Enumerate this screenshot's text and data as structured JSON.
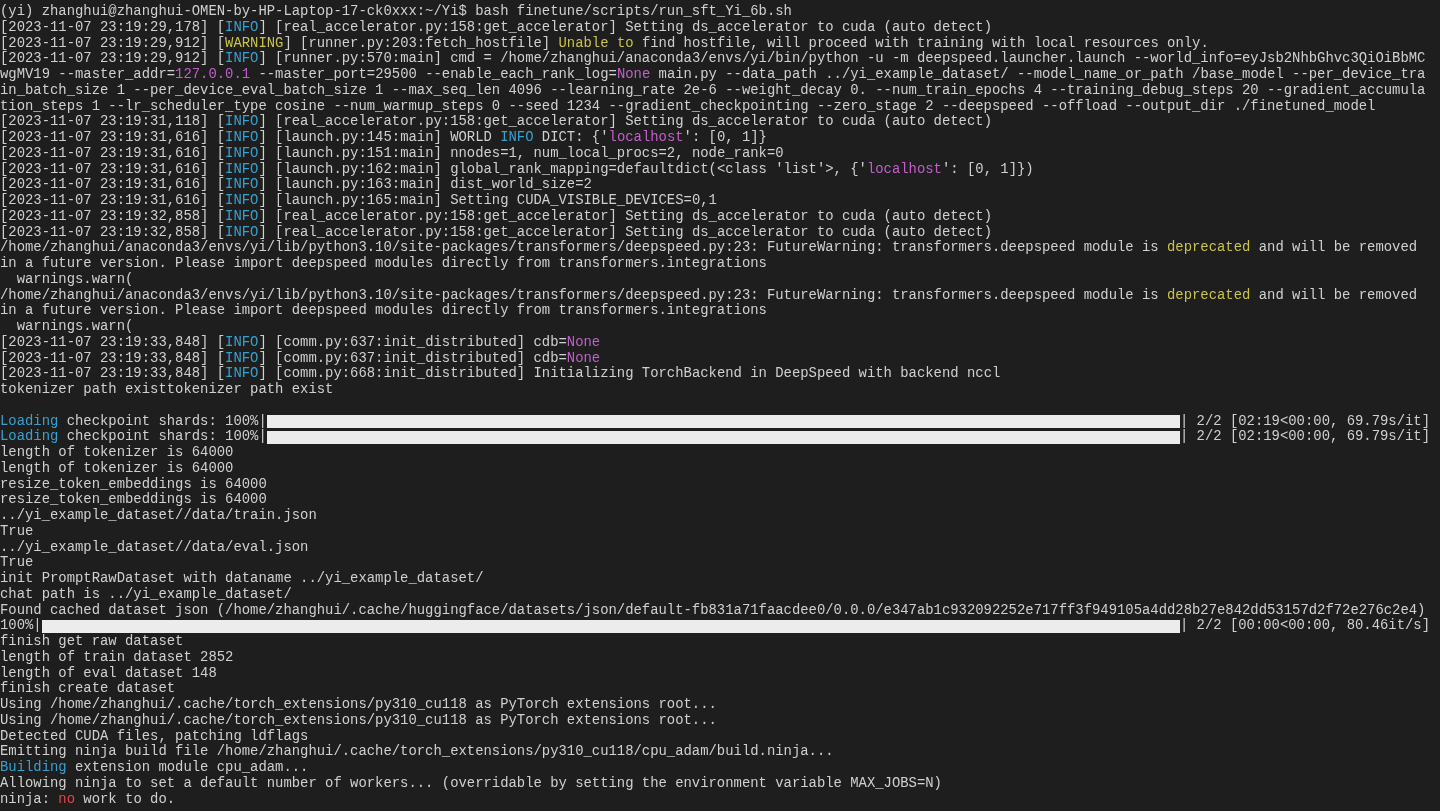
{
  "terminal": {
    "lines": [
      {
        "kind": "text",
        "segments": [
          {
            "kind": "plain",
            "text": "(yi) zhanghui@zhanghui-OMEN-by-HP-Laptop-17-ck0xxx:~/Yi$ bash finetune/scripts/run_sft_Yi_6b.sh"
          }
        ]
      },
      {
        "kind": "text",
        "segments": [
          {
            "kind": "plain",
            "text": "[2023-11-07 23:19:29,178] ["
          },
          {
            "kind": "info",
            "text": "INFO"
          },
          {
            "kind": "plain",
            "text": "] [real_accelerator.py:158:get_accelerator] Setting ds_accelerator to cuda (auto detect)"
          }
        ]
      },
      {
        "kind": "text",
        "segments": [
          {
            "kind": "plain",
            "text": "[2023-11-07 23:19:29,912] ["
          },
          {
            "kind": "warning",
            "text": "WARNING"
          },
          {
            "kind": "plain",
            "text": "] [runner.py:203:fetch_hostfile] "
          },
          {
            "kind": "warning",
            "text": "Unable to"
          },
          {
            "kind": "plain",
            "text": " find hostfile, will proceed with training with local resources only."
          }
        ]
      },
      {
        "kind": "text",
        "segments": [
          {
            "kind": "plain",
            "text": "[2023-11-07 23:19:29,912] ["
          },
          {
            "kind": "info",
            "text": "INFO"
          },
          {
            "kind": "plain",
            "text": "] [runner.py:570:main] cmd = /home/zhanghui/anaconda3/envs/yi/bin/python -u -m deepspeed.launcher.launch --world_info=eyJsb2NhbGhvc3QiOiBbMC"
          }
        ]
      },
      {
        "kind": "text",
        "segments": [
          {
            "kind": "plain",
            "text": "wgMV19 --master_addr="
          },
          {
            "kind": "value",
            "text": "127.0.0.1"
          },
          {
            "kind": "plain",
            "text": " --master_port=29500 --enable_each_rank_log="
          },
          {
            "kind": "value",
            "text": "None"
          },
          {
            "kind": "plain",
            "text": " main.py --data_path ../yi_example_dataset/ --model_name_or_path /base_model --per_device_tra"
          }
        ]
      },
      {
        "kind": "text",
        "segments": [
          {
            "kind": "plain",
            "text": "in_batch_size 1 --per_device_eval_batch_size 1 --max_seq_len 4096 --learning_rate 2e-6 --weight_decay 0. --num_train_epochs 4 --training_debug_steps 20 --gradient_accumula"
          }
        ]
      },
      {
        "kind": "text",
        "segments": [
          {
            "kind": "plain",
            "text": "tion_steps 1 --lr_scheduler_type cosine --num_warmup_steps 0 --seed 1234 --gradient_checkpointing --zero_stage 2 --deepspeed --offload --output_dir ./finetuned_model"
          }
        ]
      },
      {
        "kind": "text",
        "segments": [
          {
            "kind": "plain",
            "text": "[2023-11-07 23:19:31,118] ["
          },
          {
            "kind": "info",
            "text": "INFO"
          },
          {
            "kind": "plain",
            "text": "] [real_accelerator.py:158:get_accelerator] Setting ds_accelerator to cuda (auto detect)"
          }
        ]
      },
      {
        "kind": "text",
        "segments": [
          {
            "kind": "plain",
            "text": "[2023-11-07 23:19:31,616] ["
          },
          {
            "kind": "info",
            "text": "INFO"
          },
          {
            "kind": "plain",
            "text": "] [launch.py:145:main] WORLD "
          },
          {
            "kind": "info",
            "text": "INFO"
          },
          {
            "kind": "plain",
            "text": " DICT: {'"
          },
          {
            "kind": "value",
            "text": "localhost"
          },
          {
            "kind": "plain",
            "text": "': [0, 1]}"
          }
        ]
      },
      {
        "kind": "text",
        "segments": [
          {
            "kind": "plain",
            "text": "[2023-11-07 23:19:31,616] ["
          },
          {
            "kind": "info",
            "text": "INFO"
          },
          {
            "kind": "plain",
            "text": "] [launch.py:151:main] nnodes=1, num_local_procs=2, node_rank=0"
          }
        ]
      },
      {
        "kind": "text",
        "segments": [
          {
            "kind": "plain",
            "text": "[2023-11-07 23:19:31,616] ["
          },
          {
            "kind": "info",
            "text": "INFO"
          },
          {
            "kind": "plain",
            "text": "] [launch.py:162:main] global_rank_mapping=defaultdict(<class 'list'>, {'"
          },
          {
            "kind": "value",
            "text": "localhost"
          },
          {
            "kind": "plain",
            "text": "': [0, 1]})"
          }
        ]
      },
      {
        "kind": "text",
        "segments": [
          {
            "kind": "plain",
            "text": "[2023-11-07 23:19:31,616] ["
          },
          {
            "kind": "info",
            "text": "INFO"
          },
          {
            "kind": "plain",
            "text": "] [launch.py:163:main] dist_world_size=2"
          }
        ]
      },
      {
        "kind": "text",
        "segments": [
          {
            "kind": "plain",
            "text": "[2023-11-07 23:19:31,616] ["
          },
          {
            "kind": "info",
            "text": "INFO"
          },
          {
            "kind": "plain",
            "text": "] [launch.py:165:main] Setting CUDA_VISIBLE_DEVICES=0,1"
          }
        ]
      },
      {
        "kind": "text",
        "segments": [
          {
            "kind": "plain",
            "text": "[2023-11-07 23:19:32,858] ["
          },
          {
            "kind": "info",
            "text": "INFO"
          },
          {
            "kind": "plain",
            "text": "] [real_accelerator.py:158:get_accelerator] Setting ds_accelerator to cuda (auto detect)"
          }
        ]
      },
      {
        "kind": "text",
        "segments": [
          {
            "kind": "plain",
            "text": "[2023-11-07 23:19:32,858] ["
          },
          {
            "kind": "info",
            "text": "INFO"
          },
          {
            "kind": "plain",
            "text": "] [real_accelerator.py:158:get_accelerator] Setting ds_accelerator to cuda (auto detect)"
          }
        ]
      },
      {
        "kind": "text",
        "segments": [
          {
            "kind": "plain",
            "text": "/home/zhanghui/anaconda3/envs/yi/lib/python3.10/site-packages/transformers/deepspeed.py:23: FutureWarning: transformers.deepspeed module is "
          },
          {
            "kind": "warning",
            "text": "deprecated"
          },
          {
            "kind": "plain",
            "text": " and will be removed"
          }
        ]
      },
      {
        "kind": "text",
        "segments": [
          {
            "kind": "plain",
            "text": "in a future version. Please import deepspeed modules directly from transformers.integrations"
          }
        ]
      },
      {
        "kind": "text",
        "segments": [
          {
            "kind": "plain",
            "text": "  warnings.warn("
          }
        ]
      },
      {
        "kind": "text",
        "segments": [
          {
            "kind": "plain",
            "text": "/home/zhanghui/anaconda3/envs/yi/lib/python3.10/site-packages/transformers/deepspeed.py:23: FutureWarning: transformers.deepspeed module is "
          },
          {
            "kind": "warning",
            "text": "deprecated"
          },
          {
            "kind": "plain",
            "text": " and will be removed"
          }
        ]
      },
      {
        "kind": "text",
        "segments": [
          {
            "kind": "plain",
            "text": "in a future version. Please import deepspeed modules directly from transformers.integrations"
          }
        ]
      },
      {
        "kind": "text",
        "segments": [
          {
            "kind": "plain",
            "text": "  warnings.warn("
          }
        ]
      },
      {
        "kind": "text",
        "segments": [
          {
            "kind": "plain",
            "text": "[2023-11-07 23:19:33,848] ["
          },
          {
            "kind": "info",
            "text": "INFO"
          },
          {
            "kind": "plain",
            "text": "] [comm.py:637:init_distributed] cdb="
          },
          {
            "kind": "value",
            "text": "None"
          }
        ]
      },
      {
        "kind": "text",
        "segments": [
          {
            "kind": "plain",
            "text": "[2023-11-07 23:19:33,848] ["
          },
          {
            "kind": "info",
            "text": "INFO"
          },
          {
            "kind": "plain",
            "text": "] [comm.py:637:init_distributed] cdb="
          },
          {
            "kind": "value",
            "text": "None"
          }
        ]
      },
      {
        "kind": "text",
        "segments": [
          {
            "kind": "plain",
            "text": "[2023-11-07 23:19:33,848] ["
          },
          {
            "kind": "info",
            "text": "INFO"
          },
          {
            "kind": "plain",
            "text": "] [comm.py:668:init_distributed] Initializing TorchBackend in DeepSpeed with backend nccl"
          }
        ]
      },
      {
        "kind": "text",
        "segments": [
          {
            "kind": "plain",
            "text": "tokenizer path existtokenizer path exist"
          }
        ]
      },
      {
        "kind": "blank"
      },
      {
        "kind": "progress",
        "prefix": [
          {
            "kind": "info",
            "text": "Loading"
          },
          {
            "kind": "plain",
            "text": " checkpoint shards: 100%|"
          }
        ],
        "level": 1,
        "suffix": "| 2/2 [02:19<00:00, 69.79s/it]"
      },
      {
        "kind": "progress",
        "prefix": [
          {
            "kind": "info",
            "text": "Loading"
          },
          {
            "kind": "plain",
            "text": " checkpoint shards: 100%|"
          }
        ],
        "level": 1,
        "suffix": "| 2/2 [02:19<00:00, 69.79s/it]"
      },
      {
        "kind": "text",
        "segments": [
          {
            "kind": "plain",
            "text": "length of tokenizer is 64000"
          }
        ]
      },
      {
        "kind": "text",
        "segments": [
          {
            "kind": "plain",
            "text": "length of tokenizer is 64000"
          }
        ]
      },
      {
        "kind": "text",
        "segments": [
          {
            "kind": "plain",
            "text": "resize_token_embeddings is 64000"
          }
        ]
      },
      {
        "kind": "text",
        "segments": [
          {
            "kind": "plain",
            "text": "resize_token_embeddings is 64000"
          }
        ]
      },
      {
        "kind": "text",
        "segments": [
          {
            "kind": "plain",
            "text": "../yi_example_dataset//data/train.json"
          }
        ]
      },
      {
        "kind": "text",
        "segments": [
          {
            "kind": "plain",
            "text": "True"
          }
        ]
      },
      {
        "kind": "text",
        "segments": [
          {
            "kind": "plain",
            "text": "../yi_example_dataset//data/eval.json"
          }
        ]
      },
      {
        "kind": "text",
        "segments": [
          {
            "kind": "plain",
            "text": "True"
          }
        ]
      },
      {
        "kind": "text",
        "segments": [
          {
            "kind": "plain",
            "text": "init PromptRawDataset with dataname ../yi_example_dataset/"
          }
        ]
      },
      {
        "kind": "text",
        "segments": [
          {
            "kind": "plain",
            "text": "chat path is ../yi_example_dataset/"
          }
        ]
      },
      {
        "kind": "text",
        "segments": [
          {
            "kind": "plain",
            "text": "Found cached dataset json (/home/zhanghui/.cache/huggingface/datasets/json/default-fb831a71faacdee0/0.0.0/e347ab1c932092252e717ff3f949105a4dd28b27e842dd53157d2f72e276c2e4)"
          }
        ]
      },
      {
        "kind": "progress",
        "prefix": [
          {
            "kind": "plain",
            "text": "100%|"
          }
        ],
        "level": 1,
        "suffix": "| 2/2 [00:00<00:00, 80.46it/s]"
      },
      {
        "kind": "text",
        "segments": [
          {
            "kind": "plain",
            "text": "finish get raw dataset"
          }
        ]
      },
      {
        "kind": "text",
        "segments": [
          {
            "kind": "plain",
            "text": "length of train dataset 2852"
          }
        ]
      },
      {
        "kind": "text",
        "segments": [
          {
            "kind": "plain",
            "text": "length of eval dataset 148"
          }
        ]
      },
      {
        "kind": "text",
        "segments": [
          {
            "kind": "plain",
            "text": "finish create dataset"
          }
        ]
      },
      {
        "kind": "text",
        "segments": [
          {
            "kind": "plain",
            "text": "Using /home/zhanghui/.cache/torch_extensions/py310_cu118 as PyTorch extensions root..."
          }
        ]
      },
      {
        "kind": "text",
        "segments": [
          {
            "kind": "plain",
            "text": "Using /home/zhanghui/.cache/torch_extensions/py310_cu118 as PyTorch extensions root..."
          }
        ]
      },
      {
        "kind": "text",
        "segments": [
          {
            "kind": "plain",
            "text": "Detected CUDA files, patching ldflags"
          }
        ]
      },
      {
        "kind": "text",
        "segments": [
          {
            "kind": "plain",
            "text": "Emitting ninja build file /home/zhanghui/.cache/torch_extensions/py310_cu118/cpu_adam/build.ninja..."
          }
        ]
      },
      {
        "kind": "text",
        "segments": [
          {
            "kind": "info",
            "text": "Building"
          },
          {
            "kind": "plain",
            "text": " extension module cpu_adam..."
          }
        ]
      },
      {
        "kind": "text",
        "segments": [
          {
            "kind": "plain",
            "text": "Allowing ninja to set a default number of workers... (overridable by setting the environment variable MAX_JOBS=N)"
          }
        ]
      },
      {
        "kind": "text",
        "segments": [
          {
            "kind": "plain",
            "text": "ninja: "
          },
          {
            "kind": "error",
            "text": "no"
          },
          {
            "kind": "plain",
            "text": " work to do."
          }
        ]
      }
    ]
  }
}
